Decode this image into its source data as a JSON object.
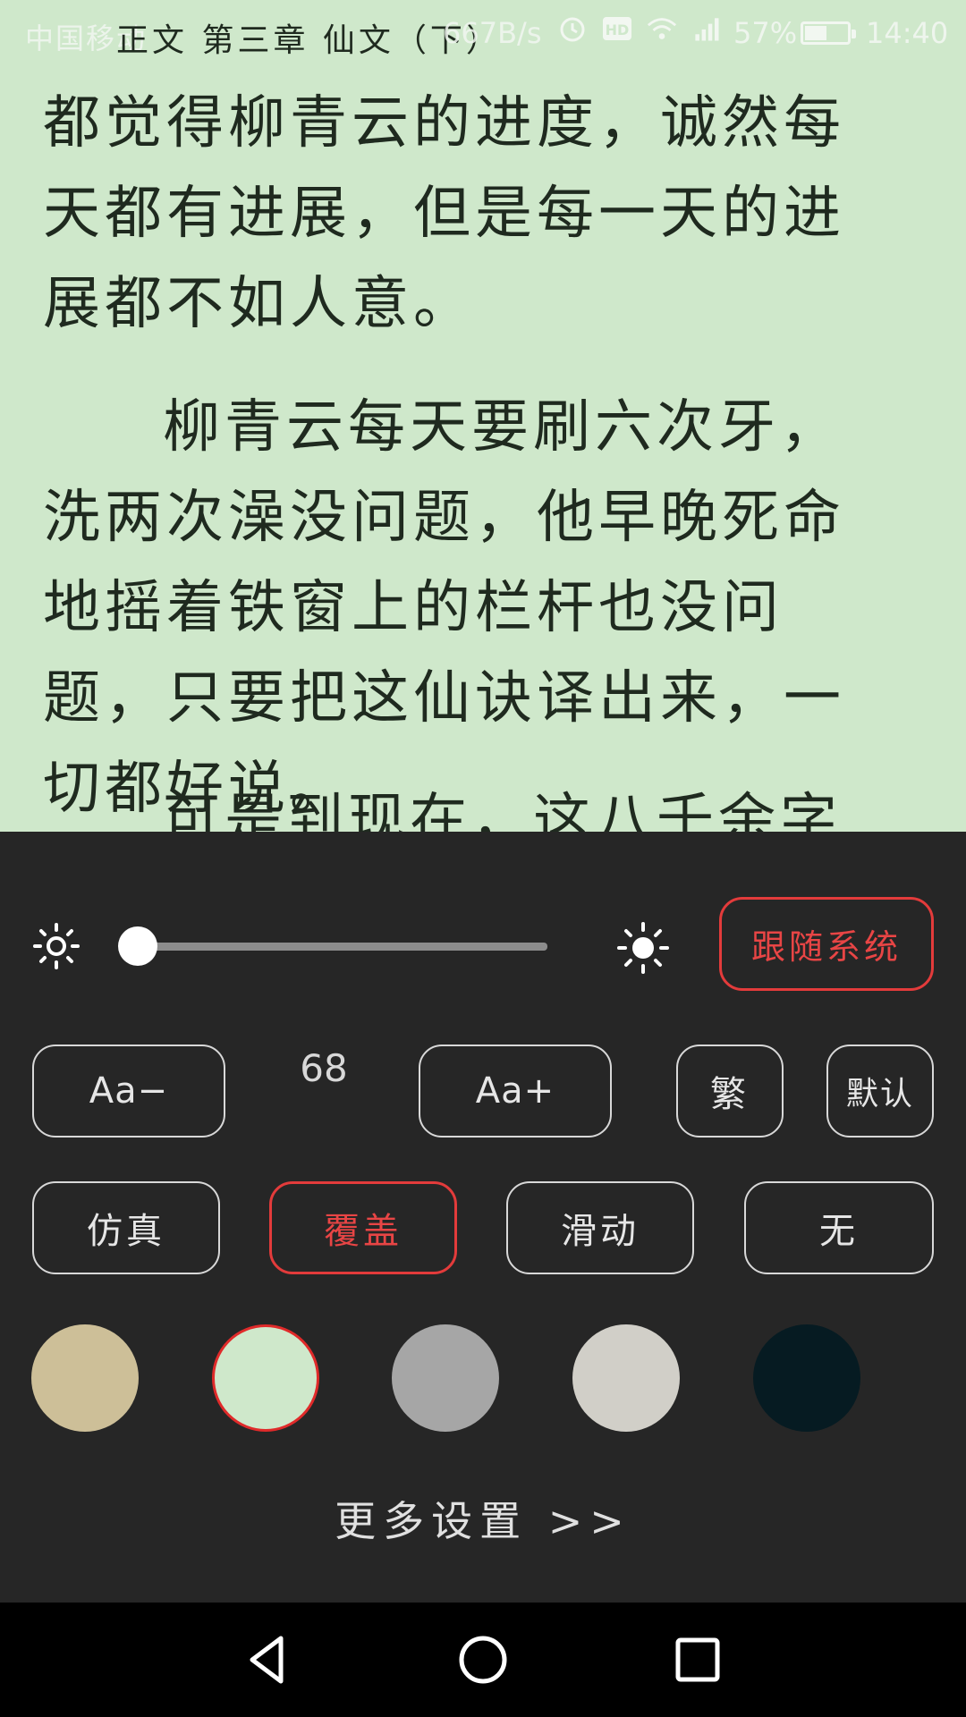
{
  "status_bar": {
    "carrier": "中国移动",
    "chapter_title": "正文 第三章 仙文（下）",
    "net_speed": "667B/s",
    "battery_percent": "57%",
    "time": "14:40"
  },
  "content": {
    "paragraphs": [
      "都觉得柳青云的进度，诚然每天都有进展，但是每一天的进展都不如人意。",
      "柳青云每天要刷六次牙，洗两次澡没问题，他早晚死命地摇着铁窗上的栏杆也没问题，只要把这仙诀译出来，一切都好说。",
      "可是到现在，这八千余字的"
    ]
  },
  "brightness": {
    "follow_system_label": "跟随系统",
    "level": 0.0
  },
  "font": {
    "decrease_label": "Aa−",
    "size_value": "68",
    "increase_label": "Aa+",
    "traditional_label": "繁",
    "default_label": "默认"
  },
  "page_turn": {
    "options": [
      "仿真",
      "覆盖",
      "滑动",
      "无"
    ],
    "selected": "覆盖"
  },
  "themes": {
    "colors": [
      "#cdbf98",
      "#cfe8cb",
      "#a6a6a6",
      "#d1cfc8",
      "#061b22"
    ],
    "selected_color": "#cfe8cb"
  },
  "more_settings_label": "更多设置 >>"
}
